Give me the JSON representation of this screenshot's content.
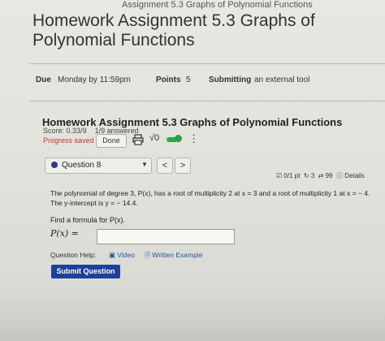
{
  "header": {
    "breadcrumb": "Assignment 5.3 Graphs of Polynomial Functions",
    "title": "Homework Assignment 5.3 Graphs of Polynomial Functions"
  },
  "meta": {
    "due_label": "Due",
    "due_value": "Monday by 11:59pm",
    "points_label": "Points",
    "points_value": "5",
    "submitting_label": "Submitting",
    "submitting_value": "an external tool"
  },
  "panel": {
    "title": "Homework Assignment 5.3 Graphs of Polynomial Functions",
    "score": "Score: 0.33/9",
    "answered": "1/9 answered",
    "progress": "Progress saved",
    "done_label": "Done",
    "sqrt_label": "√0"
  },
  "question_nav": {
    "selected": "Question 8",
    "prev": "<",
    "next": ">",
    "points": "0/1 pt",
    "retries": "3",
    "attempts": "99",
    "details": "Details"
  },
  "question": {
    "text": "The polynomial of degree 3, P(x), has a root of multiplicity 2 at x = 3 and a root of multiplicity 1 at x = − 4. The y-intercept is y = − 14.4.",
    "prompt": "Find a formula for P(x).",
    "answer_label": "P(x) =",
    "answer_value": ""
  },
  "help": {
    "label": "Question Help:",
    "video": "Video",
    "written": "Written Example"
  },
  "submit_label": "Submit Question",
  "colors": {
    "accent": "#1f3f99",
    "progress": "#c0392b",
    "toggle": "#2ea84a"
  }
}
